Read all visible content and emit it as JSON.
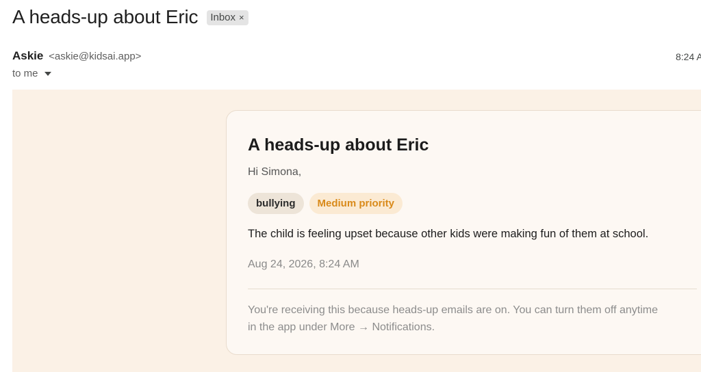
{
  "header": {
    "subject": "A heads-up about Eric",
    "label": "Inbox",
    "label_remove_glyph": "×"
  },
  "sender": {
    "name": "Askie",
    "email": "<askie@kidsai.app>",
    "time": "8:24 A",
    "recipient": "to me"
  },
  "card": {
    "title": "A heads-up about Eric",
    "greeting": "Hi Simona,",
    "tags": [
      "bullying",
      "Medium priority"
    ],
    "message": "The child is feeling upset because other kids were making fun of them at school.",
    "timestamp": "Aug 24, 2026, 8:24 AM",
    "footer_line1": "You're receiving this because heads-up emails are on. You can turn them off anytime",
    "footer_line2": "in the app under More → Notifications."
  },
  "colors": {
    "body_background": "#fbf1e6",
    "card_background": "#fdf8f3",
    "priority_text": "#d98a1a",
    "priority_background": "#fbead3",
    "topic_background": "#ede4d8"
  }
}
